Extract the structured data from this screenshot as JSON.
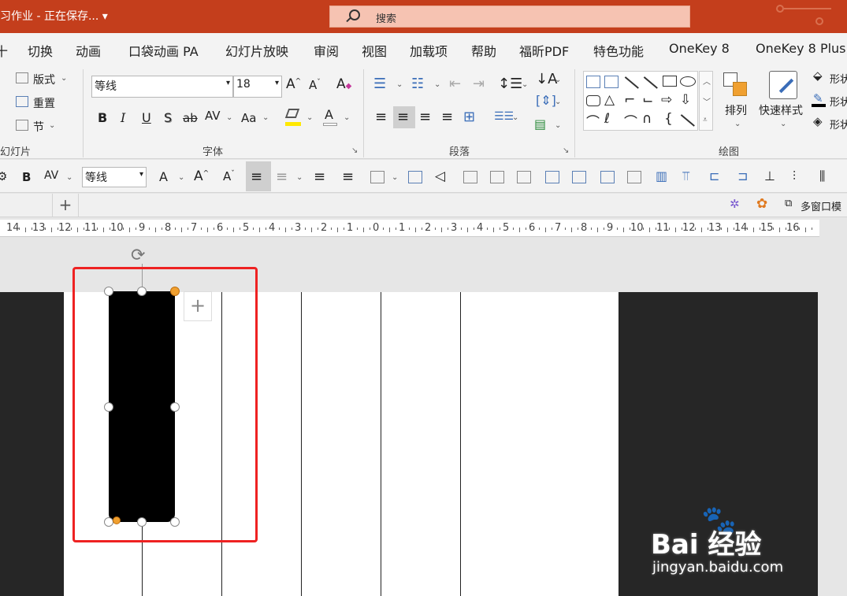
{
  "titlebar": {
    "doc_title": "习作业 - 正在保存... ▾",
    "search_label": "搜索"
  },
  "tabs": [
    "十",
    "切换",
    "动画",
    "口袋动画 PA",
    "幻灯片放映",
    "审阅",
    "视图",
    "加载项",
    "帮助",
    "福昕PDF",
    "特色功能",
    "OneKey 8",
    "OneKey 8 Plus"
  ],
  "ribbon": {
    "slides_group": {
      "layout": "版式",
      "reset": "重置",
      "section": "节",
      "label": "幻灯片"
    },
    "font_group": {
      "font_name": "等线",
      "font_size": "18",
      "bold": "B",
      "italic": "I",
      "underline": "U",
      "shadow": "S",
      "strike": "ab",
      "spacing": "AV",
      "case": "Aa",
      "label": "字体"
    },
    "paragraph_group": {
      "label": "段落"
    },
    "drawing_group": {
      "arrange": "排列",
      "quick_styles": "快速样式",
      "shape_fill": "形状",
      "shape_outline": "形状",
      "shape_effect": "形状",
      "label": "绘图"
    }
  },
  "toolbar2": {
    "bold": "B",
    "spacing": "AV",
    "font_name": "等线",
    "font_color": "A"
  },
  "tabbar": {
    "add": "+",
    "multi_window": "多窗口模"
  },
  "ruler": {
    "ticks": [
      "14",
      "13",
      "12",
      "11",
      "10",
      "9",
      "8",
      "7",
      "6",
      "5",
      "4",
      "3",
      "2",
      "1",
      "0",
      "1",
      "2",
      "3",
      "4",
      "5",
      "6",
      "7",
      "8",
      "9",
      "10",
      "11",
      "12",
      "13",
      "14",
      "15",
      "16"
    ]
  },
  "slide": {
    "add_button": "+"
  },
  "watermark": {
    "brand": "Bai 经验",
    "url": "jingyan.baidu.com"
  },
  "colors": {
    "title_bg": "#c43e1c",
    "selection_box": "#ee2222",
    "handle_accent": "#f0a030"
  }
}
